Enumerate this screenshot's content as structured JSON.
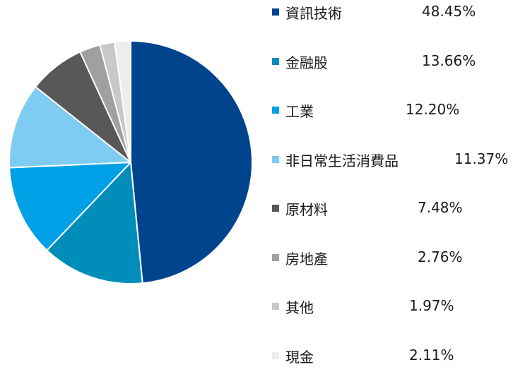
{
  "chart_data": {
    "type": "pie",
    "title": "",
    "start_angle": "12 o'clock",
    "direction": "clockwise",
    "legend_placement": "right",
    "slices": [
      {
        "label": "資訊技術",
        "value": 48.45,
        "display": "48.45%",
        "color": "#00448E"
      },
      {
        "label": "金融股",
        "value": 13.66,
        "display": "13.66%",
        "color": "#008DB9"
      },
      {
        "label": "工業",
        "value": 12.2,
        "display": "12.20%",
        "color": "#00A0E6"
      },
      {
        "label": "非日常生活消費品",
        "value": 11.37,
        "display": "11.37%",
        "color": "#7FCCF2"
      },
      {
        "label": "原材料",
        "value": 7.48,
        "display": "7.48%",
        "color": "#595859"
      },
      {
        "label": "房地產",
        "value": 2.76,
        "display": "2.76%",
        "color": "#A0A0A0"
      },
      {
        "label": "其他",
        "value": 1.97,
        "display": "1.97%",
        "color": "#C8C8CA"
      },
      {
        "label": "現金",
        "value": 2.11,
        "display": "2.11%",
        "color": "#EDEDED"
      }
    ]
  }
}
